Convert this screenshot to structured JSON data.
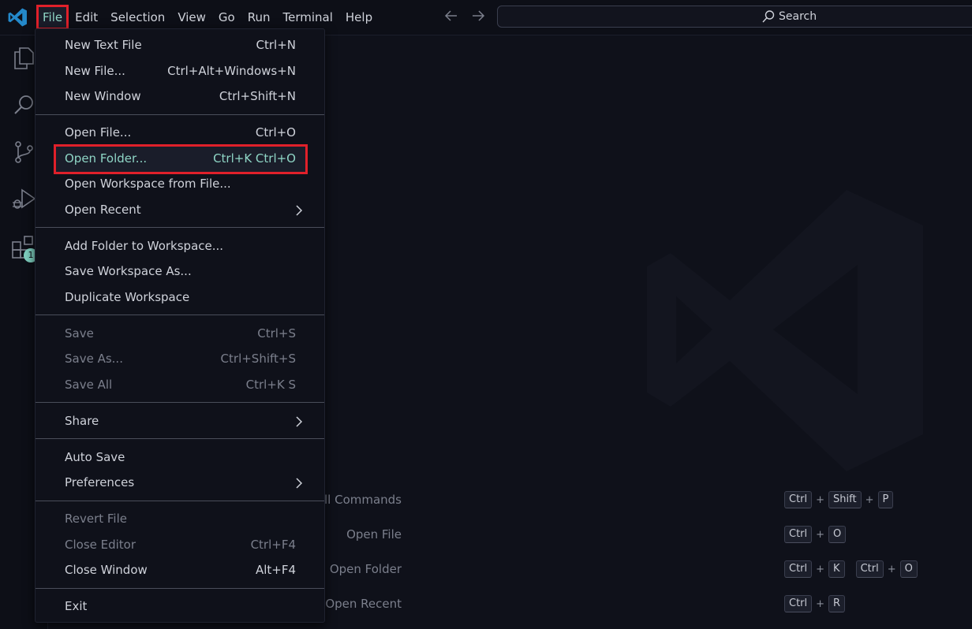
{
  "menubar": {
    "items": [
      "File",
      "Edit",
      "Selection",
      "View",
      "Go",
      "Run",
      "Terminal",
      "Help"
    ]
  },
  "search": {
    "label": "Search"
  },
  "activity": {
    "extensions_badge": "1"
  },
  "file_menu": {
    "items": [
      {
        "label": "New Text File",
        "key": "Ctrl+N"
      },
      {
        "label": "New File...",
        "key": "Ctrl+Alt+Windows+N"
      },
      {
        "label": "New Window",
        "key": "Ctrl+Shift+N"
      },
      {
        "label": "Open File...",
        "key": "Ctrl+O"
      },
      {
        "label": "Open Folder...",
        "key": "Ctrl+K Ctrl+O"
      },
      {
        "label": "Open Workspace from File...",
        "key": ""
      },
      {
        "label": "Open Recent",
        "key": ""
      },
      {
        "label": "Add Folder to Workspace...",
        "key": ""
      },
      {
        "label": "Save Workspace As...",
        "key": ""
      },
      {
        "label": "Duplicate Workspace",
        "key": ""
      },
      {
        "label": "Save",
        "key": "Ctrl+S"
      },
      {
        "label": "Save As...",
        "key": "Ctrl+Shift+S"
      },
      {
        "label": "Save All",
        "key": "Ctrl+K S"
      },
      {
        "label": "Share",
        "key": ""
      },
      {
        "label": "Auto Save",
        "key": ""
      },
      {
        "label": "Preferences",
        "key": ""
      },
      {
        "label": "Revert File",
        "key": ""
      },
      {
        "label": "Close Editor",
        "key": "Ctrl+F4"
      },
      {
        "label": "Close Window",
        "key": "Alt+F4"
      },
      {
        "label": "Exit",
        "key": ""
      }
    ]
  },
  "shortcuts": [
    {
      "label": "Show All Commands",
      "keys": [
        "Ctrl",
        "Shift",
        "P"
      ]
    },
    {
      "label": "Open File",
      "keys": [
        "Ctrl",
        "O"
      ]
    },
    {
      "label": "Open Folder",
      "keys": [
        "Ctrl",
        "K"
      ],
      "keys2": [
        "Ctrl",
        "O"
      ]
    },
    {
      "label": "Open Recent",
      "keys": [
        "Ctrl",
        "R"
      ]
    }
  ],
  "colors": {
    "accent": "#8fd6c6",
    "highlight_border": "#e0202a",
    "background": "#0f111a"
  }
}
